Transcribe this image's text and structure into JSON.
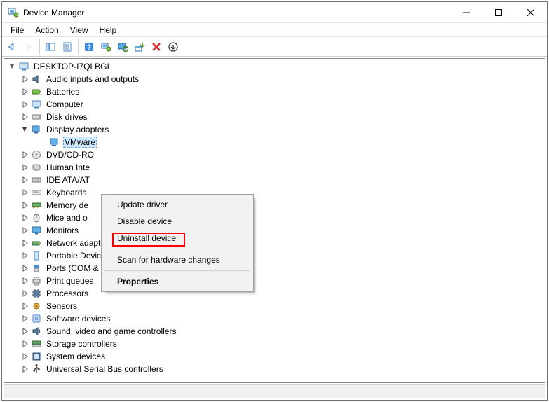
{
  "title": "Device Manager",
  "menu": {
    "file": "File",
    "action": "Action",
    "view": "View",
    "help": "Help"
  },
  "toolbar_icons": {
    "back": "back-arrow-icon",
    "forward": "forward-arrow-icon",
    "show_hide": "show-hide-console-tree-icon",
    "properties": "properties-icon",
    "help": "help-icon",
    "action_icon": "toolbar-app-icon",
    "monitor": "scan-hardware-changes-icon",
    "add_legacy": "add-legacy-hardware-icon",
    "uninstall": "uninstall-device-icon",
    "update_drv": "update-driver-icon"
  },
  "tree": {
    "root": "DESKTOP-I7QLBGI",
    "nodes": [
      {
        "label": "Audio inputs and outputs",
        "icon": "audio-icon"
      },
      {
        "label": "Batteries",
        "icon": "battery-icon"
      },
      {
        "label": "Computer",
        "icon": "computer-icon"
      },
      {
        "label": "Disk drives",
        "icon": "disk-drive-icon"
      },
      {
        "label": "Display adapters",
        "icon": "display-adapter-icon",
        "expanded": true,
        "children": [
          {
            "label": "VMware",
            "icon": "display-adapter-icon",
            "selected": true
          }
        ]
      },
      {
        "label": "DVD/CD-RO",
        "icon": "optical-drive-icon",
        "truncated": true
      },
      {
        "label": "Human Inte",
        "icon": "hid-icon",
        "truncated": true
      },
      {
        "label": "IDE ATA/AT",
        "icon": "ide-icon",
        "truncated": true
      },
      {
        "label": "Keyboards",
        "icon": "keyboard-icon"
      },
      {
        "label": "Memory de",
        "icon": "memory-icon",
        "truncated": true
      },
      {
        "label": "Mice and o",
        "icon": "mouse-icon",
        "truncated": true
      },
      {
        "label": "Monitors",
        "icon": "monitor-icon"
      },
      {
        "label": "Network adapters",
        "icon": "network-adapter-icon"
      },
      {
        "label": "Portable Devices",
        "icon": "portable-device-icon"
      },
      {
        "label": "Ports (COM & LPT)",
        "icon": "port-icon"
      },
      {
        "label": "Print queues",
        "icon": "printer-icon"
      },
      {
        "label": "Processors",
        "icon": "processor-icon"
      },
      {
        "label": "Sensors",
        "icon": "sensor-icon"
      },
      {
        "label": "Software devices",
        "icon": "software-device-icon"
      },
      {
        "label": "Sound, video and game controllers",
        "icon": "sound-controller-icon"
      },
      {
        "label": "Storage controllers",
        "icon": "storage-controller-icon"
      },
      {
        "label": "System devices",
        "icon": "system-device-icon"
      },
      {
        "label": "Universal Serial Bus controllers",
        "icon": "usb-controller-icon"
      }
    ]
  },
  "context_menu": {
    "update": "Update driver",
    "disable": "Disable device",
    "uninstall": "Uninstall device",
    "scan": "Scan for hardware changes",
    "properties": "Properties"
  }
}
